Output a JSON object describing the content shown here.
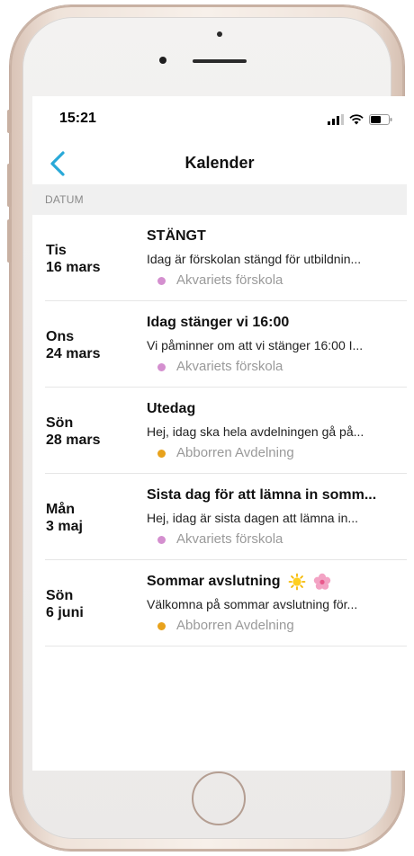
{
  "status_bar": {
    "time": "15:21"
  },
  "nav": {
    "title": "Kalender",
    "back_icon": "chevron-left-icon",
    "accent_color": "#29a9d8"
  },
  "section": {
    "header": "DATUM"
  },
  "events": [
    {
      "weekday": "Tis",
      "date": "16 mars",
      "title": "STÄNGT",
      "description": "Idag är förskolan stängd för utbildnin...",
      "tag": "Akvariets förskola",
      "tag_color": "#d48fcf"
    },
    {
      "weekday": "Ons",
      "date": "24 mars",
      "title": "Idag stänger vi 16:00",
      "description": "Vi påminner om att vi stänger 16:00 I...",
      "tag": "Akvariets förskola",
      "tag_color": "#d48fcf"
    },
    {
      "weekday": "Sön",
      "date": "28 mars",
      "title": "Utedag",
      "description": "Hej, idag ska hela avdelningen gå på...",
      "tag": "Abborren Avdelning",
      "tag_color": "#e8a21c"
    },
    {
      "weekday": "Mån",
      "date": "3 maj",
      "title": "Sista dag för att lämna in somm...",
      "description": "Hej, idag är sista dagen att lämna in...",
      "tag": "Akvariets förskola",
      "tag_color": "#d48fcf"
    },
    {
      "weekday": "Sön",
      "date": "6 juni",
      "title": "Sommar avslutning",
      "title_icons": [
        "sun-icon",
        "flower-icon"
      ],
      "description": "Välkomna på sommar avslutning för...",
      "tag": "Abborren Avdelning",
      "tag_color": "#e8a21c"
    }
  ]
}
